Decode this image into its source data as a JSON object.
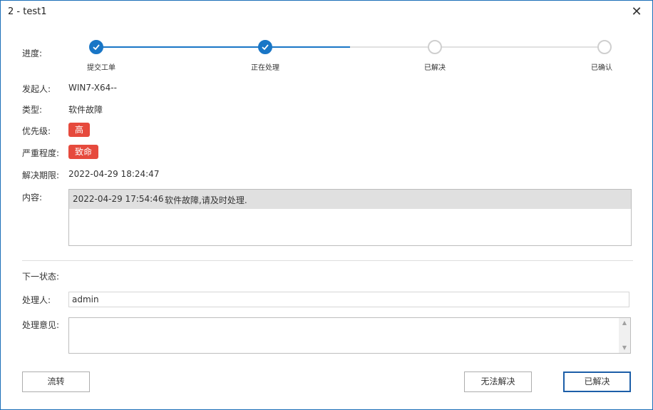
{
  "window": {
    "title": "2 - test1",
    "close_glyph": "✕"
  },
  "labels": {
    "progress": "进度:",
    "initiator": "发起人:",
    "type": "类型:",
    "priority": "优先级:",
    "severity": "严重程度:",
    "deadline": "解决期限:",
    "content": "内容:",
    "next_state": "下一状态:",
    "handler": "处理人:",
    "opinion": "处理意见:"
  },
  "progress": {
    "steps": [
      {
        "label": "提交工单",
        "state": "done"
      },
      {
        "label": "正在处理",
        "state": "done"
      },
      {
        "label": "已解决",
        "state": "todo"
      },
      {
        "label": "已确认",
        "state": "todo"
      }
    ],
    "colors": {
      "done": "#1976c6",
      "todo": "#cfcfcf"
    }
  },
  "values": {
    "initiator": "WIN7-X64--",
    "type": "软件故障",
    "priority": "高",
    "severity": "致命",
    "deadline": "2022-04-29 18:24:47"
  },
  "content": {
    "time": "2022-04-29 17:54:46",
    "message": "软件故障,请及时处理."
  },
  "handler": {
    "value": "admin"
  },
  "opinion": {
    "value": ""
  },
  "buttons": {
    "transfer": "流转",
    "cannot_resolve": "无法解决",
    "resolved": "已解决"
  },
  "colors": {
    "tag_red": "#e64a3d",
    "accent": "#1976c6"
  }
}
